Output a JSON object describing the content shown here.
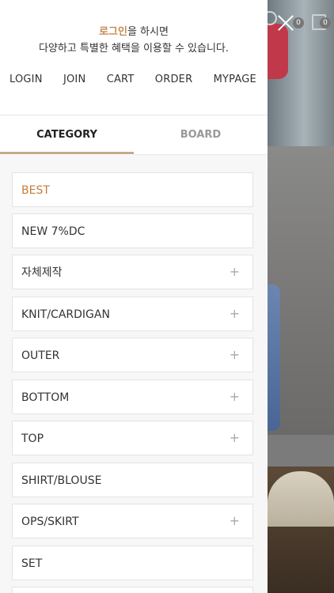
{
  "drawer": {
    "login_highlight": "로그인",
    "login_rest": "을 하시면",
    "login_line2": "다양하고 특별한 혜택을 이용할 수 있습니다.",
    "nav": [
      "LOGIN",
      "JOIN",
      "CART",
      "ORDER",
      "MYPAGE"
    ],
    "tabs": [
      {
        "label": "CATEGORY",
        "active": true
      },
      {
        "label": "BOARD",
        "active": false
      }
    ],
    "categories": [
      {
        "label": "BEST",
        "expandable": false,
        "highlight": true
      },
      {
        "label": "NEW 7%DC",
        "expandable": false
      },
      {
        "label": "자체제작",
        "expandable": true
      },
      {
        "label": "KNIT/CARDIGAN",
        "expandable": true
      },
      {
        "label": "OUTER",
        "expandable": true
      },
      {
        "label": "BOTTOM",
        "expandable": true
      },
      {
        "label": "TOP",
        "expandable": true
      },
      {
        "label": "SHIRT/BLOUSE",
        "expandable": false
      },
      {
        "label": "OPS/SKIRT",
        "expandable": true
      },
      {
        "label": "SET",
        "expandable": false
      }
    ],
    "plus_glyph": "+"
  },
  "header_icons": {
    "close_icon": "close-icon",
    "badge_left": "0",
    "badge_right": "0"
  },
  "colors": {
    "accent": "#c58a53",
    "best": "#c57d3c",
    "tab_underline": "#c6a88c"
  }
}
